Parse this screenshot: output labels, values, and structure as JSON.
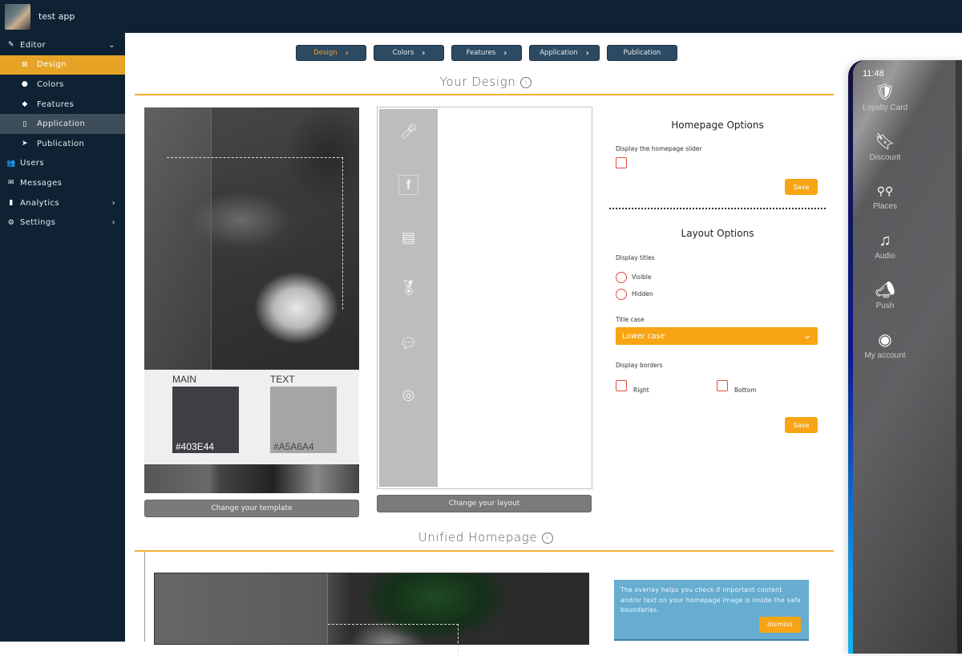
{
  "app": {
    "name": "test app"
  },
  "sidebar": {
    "items": [
      {
        "label": "Editor",
        "icon": "pencil-icon",
        "chevron": "⌄"
      },
      {
        "label": "Design",
        "icon": "design-grid-icon"
      },
      {
        "label": "Colors",
        "icon": "palette-icon"
      },
      {
        "label": "Features",
        "icon": "cube-icon"
      },
      {
        "label": "Application",
        "icon": "mobile-icon"
      },
      {
        "label": "Publication",
        "icon": "paper-plane-icon"
      },
      {
        "label": "Users",
        "icon": "users-icon"
      },
      {
        "label": "Messages",
        "icon": "envelope-icon"
      },
      {
        "label": "Analytics",
        "icon": "chart-icon",
        "chevron": "›"
      },
      {
        "label": "Settings",
        "icon": "cogs-icon",
        "chevron": "›"
      }
    ]
  },
  "steps": [
    {
      "label": "Design",
      "arrow": "›"
    },
    {
      "label": "Colors",
      "arrow": "›"
    },
    {
      "label": "Features",
      "arrow": "›"
    },
    {
      "label": "Application",
      "arrow": "›"
    },
    {
      "label": "Publication"
    }
  ],
  "your_design": {
    "title": "Your Design",
    "info": "i",
    "template": {
      "main_label": "MAIN",
      "main_color": "#403E44",
      "text_label": "TEXT",
      "text_color": "#A5A6A4",
      "change_button": "Change your template"
    },
    "layout": {
      "change_button": "Change your layout",
      "icons": [
        "microphone-icon",
        "facebook-icon",
        "form-icon",
        "medal-icon",
        "chat-icon",
        "user-settings-icon"
      ]
    }
  },
  "homepage_options": {
    "title": "Homepage Options",
    "slider_label": "Display the homepage slider",
    "slider_checked": false,
    "save": "Save"
  },
  "layout_options": {
    "title": "Layout Options",
    "display_titles_label": "Display titles",
    "visible_label": "Visible",
    "hidden_label": "Hidden",
    "title_case_label": "Title case",
    "title_case_value": "Lower case",
    "display_borders_label": "Display borders",
    "right_label": "Right",
    "bottom_label": "Bottom",
    "save": "Save"
  },
  "unified_homepage": {
    "title": "Unified Homepage",
    "info": "i",
    "tip": "The overlay helps you check if important content and/or text on your homepage image is inside the safe boundaries.",
    "dismiss": "dismiss"
  },
  "phone": {
    "time": "11:48",
    "items": [
      {
        "label": "Loyalty Card",
        "icon": "shield-check-icon"
      },
      {
        "label": "Discount",
        "icon": "bookmark-star-icon"
      },
      {
        "label": "Places",
        "icon": "map-pins-icon"
      },
      {
        "label": "Audio",
        "icon": "music-note-icon"
      },
      {
        "label": "Push",
        "icon": "megaphone-icon"
      },
      {
        "label": "My account",
        "icon": "user-circle-icon"
      }
    ]
  },
  "colors": {
    "sidebar_bg": "#0F2233",
    "accent": "#F7A514",
    "step_bg": "#2C4A62",
    "active_nav": "#E6A326",
    "checkbox_border": "#E14A43",
    "tip_bg": "#67ADD0"
  }
}
